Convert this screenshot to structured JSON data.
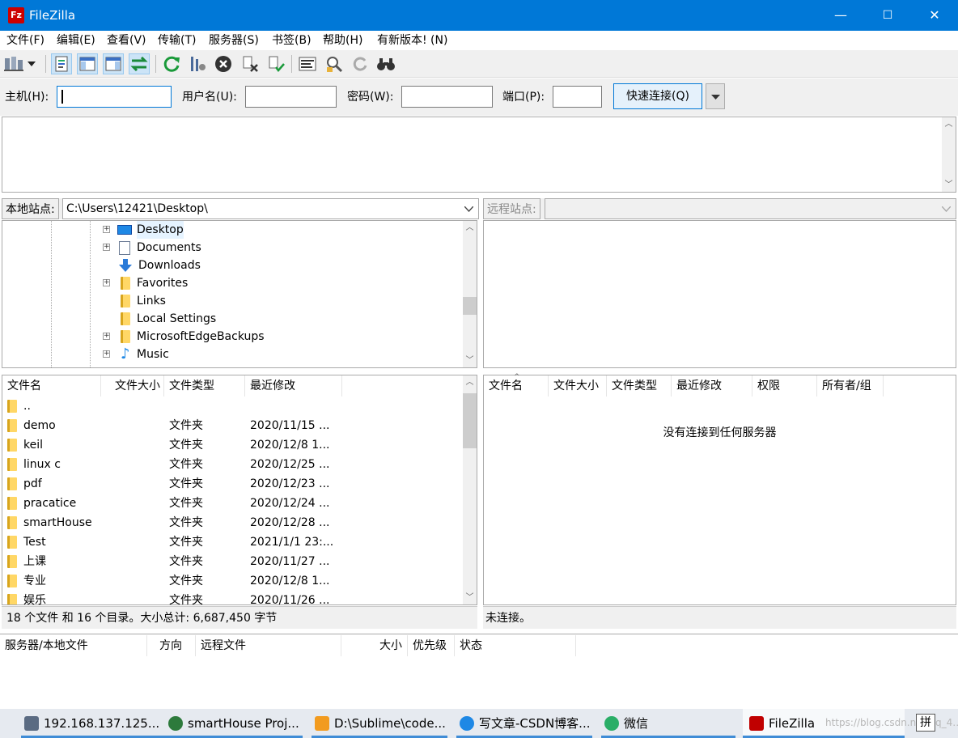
{
  "title": "FileZilla",
  "window_controls": {
    "minimize": "—",
    "maximize": "☐",
    "close": "✕"
  },
  "menu": [
    "文件(F)",
    "编辑(E)",
    "查看(V)",
    "传输(T)",
    "服务器(S)",
    "书签(B)",
    "帮助(H)",
    "有新版本! (N)"
  ],
  "toolbar": [
    "site-manager-icon",
    "dropdown-arrow-icon",
    "toggle-log-icon",
    "toggle-local-tree-icon",
    "toggle-remote-tree-icon",
    "toggle-queue-icon",
    "refresh-icon",
    "process-queue-icon",
    "cancel-icon",
    "disconnect-icon",
    "reconnect-icon",
    "directory-listing-filter-icon",
    "compare-icon",
    "sync-browse-icon",
    "search-icon"
  ],
  "quickconnect": {
    "host_label": "主机(H):",
    "user_label": "用户名(U):",
    "pass_label": "密码(W):",
    "port_label": "端口(P):",
    "host_value": "",
    "user_value": "",
    "pass_value": "",
    "port_value": "",
    "button": "快速连接(Q)"
  },
  "local": {
    "site_label": "本地站点:",
    "path": "C:\\Users\\12421\\Desktop\\",
    "tree": [
      {
        "name": "Desktop",
        "icon": "desktop-icon",
        "expander": true
      },
      {
        "name": "Documents",
        "icon": "documents-icon",
        "expander": true
      },
      {
        "name": "Downloads",
        "icon": "downloads-icon",
        "expander": false
      },
      {
        "name": "Favorites",
        "icon": "favorites-icon",
        "expander": true
      },
      {
        "name": "Links",
        "icon": "links-icon",
        "expander": false
      },
      {
        "name": "Local Settings",
        "icon": "folder-icon",
        "expander": false
      },
      {
        "name": "MicrosoftEdgeBackups",
        "icon": "folder-icon",
        "expander": true
      },
      {
        "name": "Music",
        "icon": "music-icon",
        "expander": true
      }
    ],
    "columns": [
      "文件名",
      "文件大小",
      "文件类型",
      "最近修改"
    ],
    "files": [
      {
        "name": "..",
        "size": "",
        "type": "",
        "modified": ""
      },
      {
        "name": "demo",
        "size": "",
        "type": "文件夹",
        "modified": "2020/11/15 ..."
      },
      {
        "name": "keil",
        "size": "",
        "type": "文件夹",
        "modified": "2020/12/8 1..."
      },
      {
        "name": "linux c",
        "size": "",
        "type": "文件夹",
        "modified": "2020/12/25 ..."
      },
      {
        "name": "pdf",
        "size": "",
        "type": "文件夹",
        "modified": "2020/12/23 ..."
      },
      {
        "name": "pracatice",
        "size": "",
        "type": "文件夹",
        "modified": "2020/12/24 ..."
      },
      {
        "name": "smartHouse",
        "size": "",
        "type": "文件夹",
        "modified": "2020/12/28 ..."
      },
      {
        "name": "Test",
        "size": "",
        "type": "文件夹",
        "modified": "2021/1/1 23:..."
      },
      {
        "name": "上课",
        "size": "",
        "type": "文件夹",
        "modified": "2020/11/27 ..."
      },
      {
        "name": "专业",
        "size": "",
        "type": "文件夹",
        "modified": "2020/12/8 1..."
      },
      {
        "name": "娱乐",
        "size": "",
        "type": "文件夹",
        "modified": "2020/11/26 ..."
      }
    ],
    "status": "18 个文件 和 16 个目录。大小总计: 6,687,450 字节"
  },
  "remote": {
    "site_label": "远程站点:",
    "path": "",
    "columns": [
      "文件名",
      "文件大小",
      "文件类型",
      "最近修改",
      "权限",
      "所有者/组"
    ],
    "empty_message": "没有连接到任何服务器",
    "status": "未连接。"
  },
  "queue": {
    "columns": [
      "服务器/本地文件",
      "方向",
      "远程文件",
      "大小",
      "优先级",
      "状态"
    ]
  },
  "taskbar": [
    {
      "label": "192.168.137.125...",
      "color": "#5a6b82"
    },
    {
      "label": "smartHouse Proj...",
      "color": "#2d7a3c"
    },
    {
      "label": "D:\\Sublime\\code...",
      "color": "#f29b1f"
    },
    {
      "label": "写文章-CSDN博客...",
      "color": "#1e88e5"
    },
    {
      "label": "微信",
      "color": "#2aae67"
    },
    {
      "label": "FileZilla",
      "color": "#c00000"
    }
  ],
  "ime_indicator": "拼",
  "watermark": "https://blog.csdn.net/qq_4…xx"
}
